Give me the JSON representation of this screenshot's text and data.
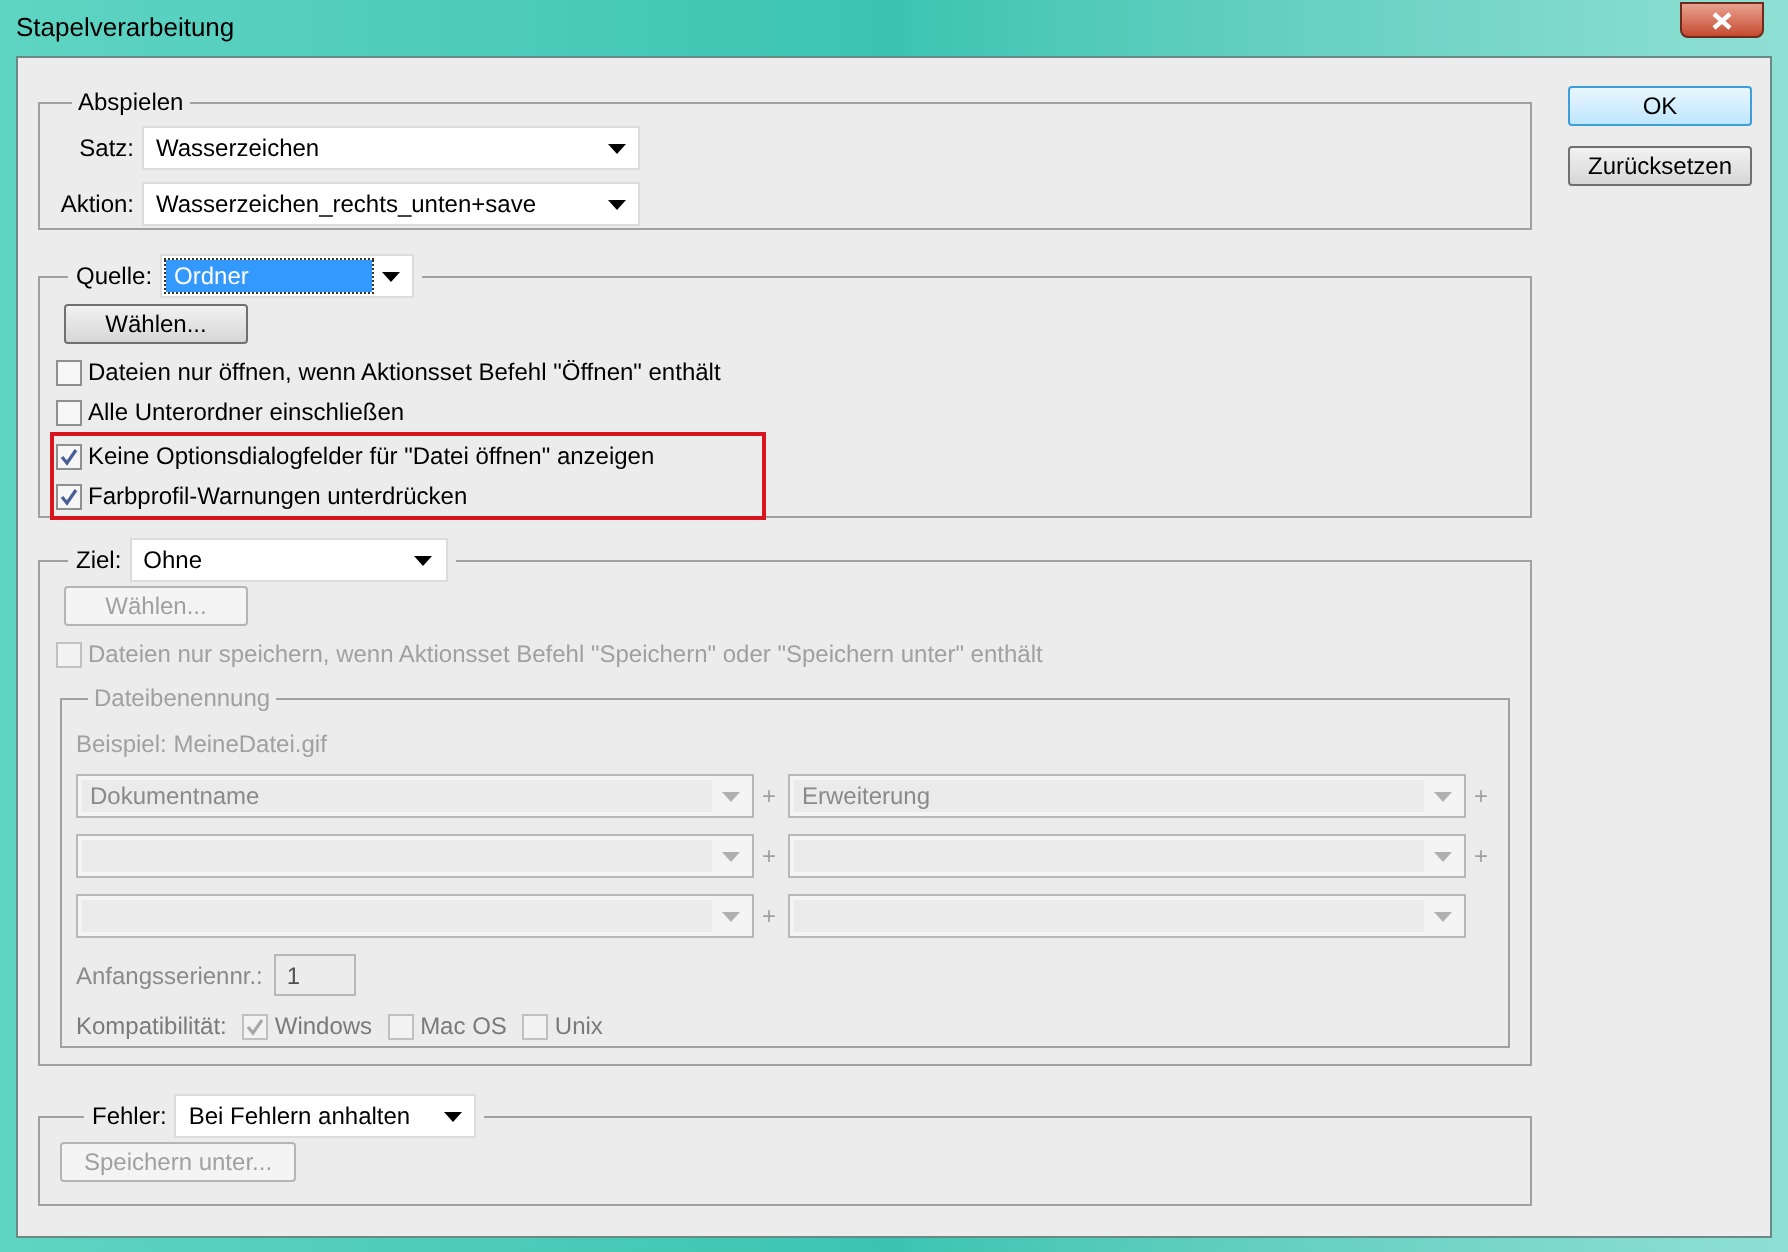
{
  "window": {
    "title": "Stapelverarbeitung"
  },
  "abspielen": {
    "title": "Abspielen",
    "fields": [
      {
        "label": "Satz:",
        "value": "Wasserzeichen"
      },
      {
        "label": "Aktion:",
        "value": "Wasserzeichen_rechts_unten+save"
      }
    ]
  },
  "quelle": {
    "label": "Quelle:",
    "value": "Ordner",
    "focused": true,
    "button": {
      "label": "Wählen...",
      "disabled": false
    },
    "options": [
      {
        "label": "Dateien nur öffnen, wenn Aktionsset Befehl \"Öffnen\" enthält",
        "checked": false,
        "highlighted": false
      },
      {
        "label": "Alle Unterordner einschließen",
        "checked": false,
        "highlighted": false
      },
      {
        "label": "Keine Optionsdialogfelder für \"Datei öffnen\" anzeigen",
        "checked": true,
        "highlighted": true
      },
      {
        "label": "Farbprofil-Warnungen unterdrücken",
        "checked": true,
        "highlighted": true
      }
    ]
  },
  "ziel": {
    "label": "Ziel:",
    "value": "Ohne",
    "button": {
      "label": "Wählen...",
      "disabled": true
    },
    "options": [
      {
        "label": "Dateien nur speichern, wenn Aktionsset Befehl \"Speichern\" oder \"Speichern unter\" enthält",
        "checked": false,
        "disabled": true
      }
    ],
    "naming": {
      "title": "Dateibenennung",
      "example": "Beispiel: MeineDatei.gif",
      "rows": [
        {
          "slots": [
            {
              "kind": "dropdown",
              "value": "Dokumentname",
              "plus": "+"
            },
            {
              "kind": "dropdown",
              "value": "Erweiterung",
              "plus": "+"
            }
          ]
        },
        {
          "slots": [
            {
              "kind": "dropdown",
              "plus": "+"
            },
            {
              "kind": "dropdown",
              "plus": "+"
            }
          ]
        },
        {
          "slots": [
            {
              "kind": "dropdown",
              "plus": "+"
            },
            {
              "kind": "dropdown"
            }
          ]
        }
      ],
      "serial": {
        "label": "Anfangsseriennr.:",
        "value": "1"
      },
      "compat": {
        "label": "Kompatibilität:",
        "options": [
          {
            "label": "Windows",
            "checked": true
          },
          {
            "label": "Mac OS",
            "checked": false
          },
          {
            "label": "Unix",
            "checked": false
          }
        ]
      }
    }
  },
  "fehler": {
    "label": "Fehler:",
    "value": "Bei Fehlern anhalten",
    "button": {
      "label": "Speichern unter...",
      "disabled": true
    }
  },
  "buttons": [
    {
      "label": "OK",
      "default": true
    },
    {
      "label": "Zurücksetzen",
      "default": false
    }
  ]
}
